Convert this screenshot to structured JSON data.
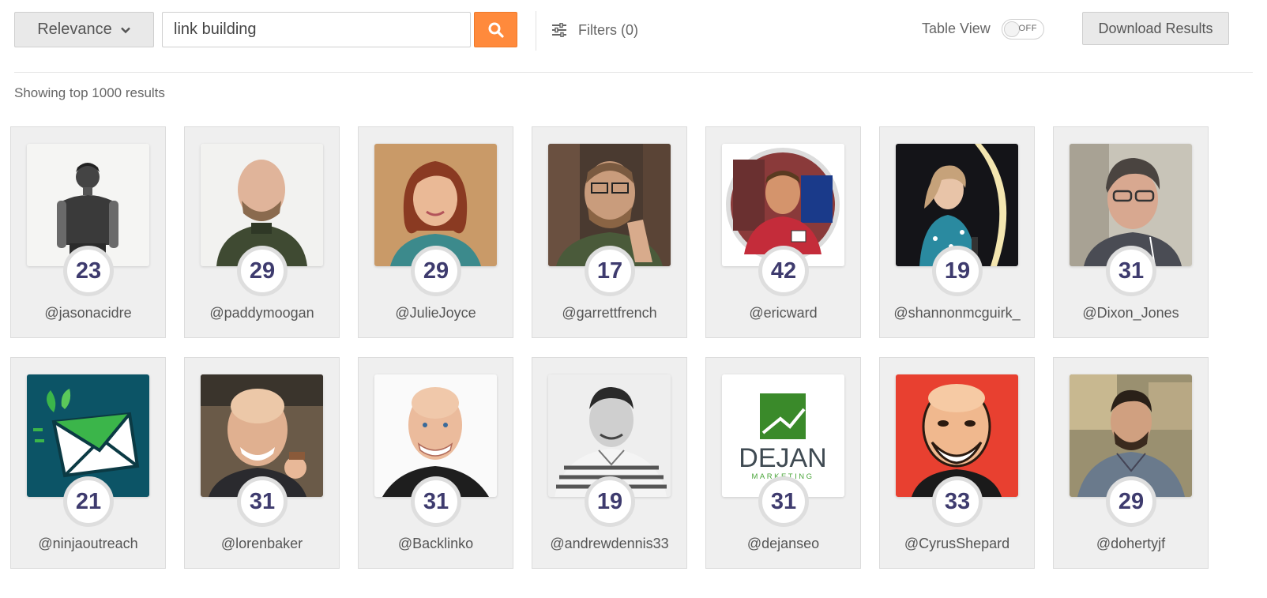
{
  "toolbar": {
    "sort_label": "Relevance",
    "search_value": "link building",
    "filters_label": "Filters (0)",
    "table_view_label": "Table View",
    "toggle_state": "OFF",
    "download_label": "Download Results",
    "accent_color": "#ff8a3c"
  },
  "results_label": "Showing top 1000 results",
  "cards": [
    {
      "handle": "@jasonacidre",
      "score": "23",
      "avatar": "person-photo-grayscale"
    },
    {
      "handle": "@paddymoogan",
      "score": "29",
      "avatar": "person-photo"
    },
    {
      "handle": "@JulieJoyce",
      "score": "29",
      "avatar": "person-photo"
    },
    {
      "handle": "@garrettfrench",
      "score": "17",
      "avatar": "person-photo"
    },
    {
      "handle": "@ericward",
      "score": "42",
      "avatar": "person-photo-circle"
    },
    {
      "handle": "@shannonmcguirk_",
      "score": "19",
      "avatar": "person-photo"
    },
    {
      "handle": "@Dixon_Jones",
      "score": "31",
      "avatar": "person-photo"
    },
    {
      "handle": "@ninjaoutreach",
      "score": "21",
      "avatar": "envelope-logo"
    },
    {
      "handle": "@lorenbaker",
      "score": "31",
      "avatar": "person-photo"
    },
    {
      "handle": "@Backlinko",
      "score": "31",
      "avatar": "person-photo"
    },
    {
      "handle": "@andrewdennis33",
      "score": "19",
      "avatar": "person-photo-grayscale"
    },
    {
      "handle": "@dejanseo",
      "score": "31",
      "avatar": "dejan-logo",
      "logo_text": "DEJAN",
      "logo_subtext": "MARKETING"
    },
    {
      "handle": "@CyrusShepard",
      "score": "33",
      "avatar": "cartoon-portrait"
    },
    {
      "handle": "@dohertyjf",
      "score": "29",
      "avatar": "person-photo"
    }
  ]
}
